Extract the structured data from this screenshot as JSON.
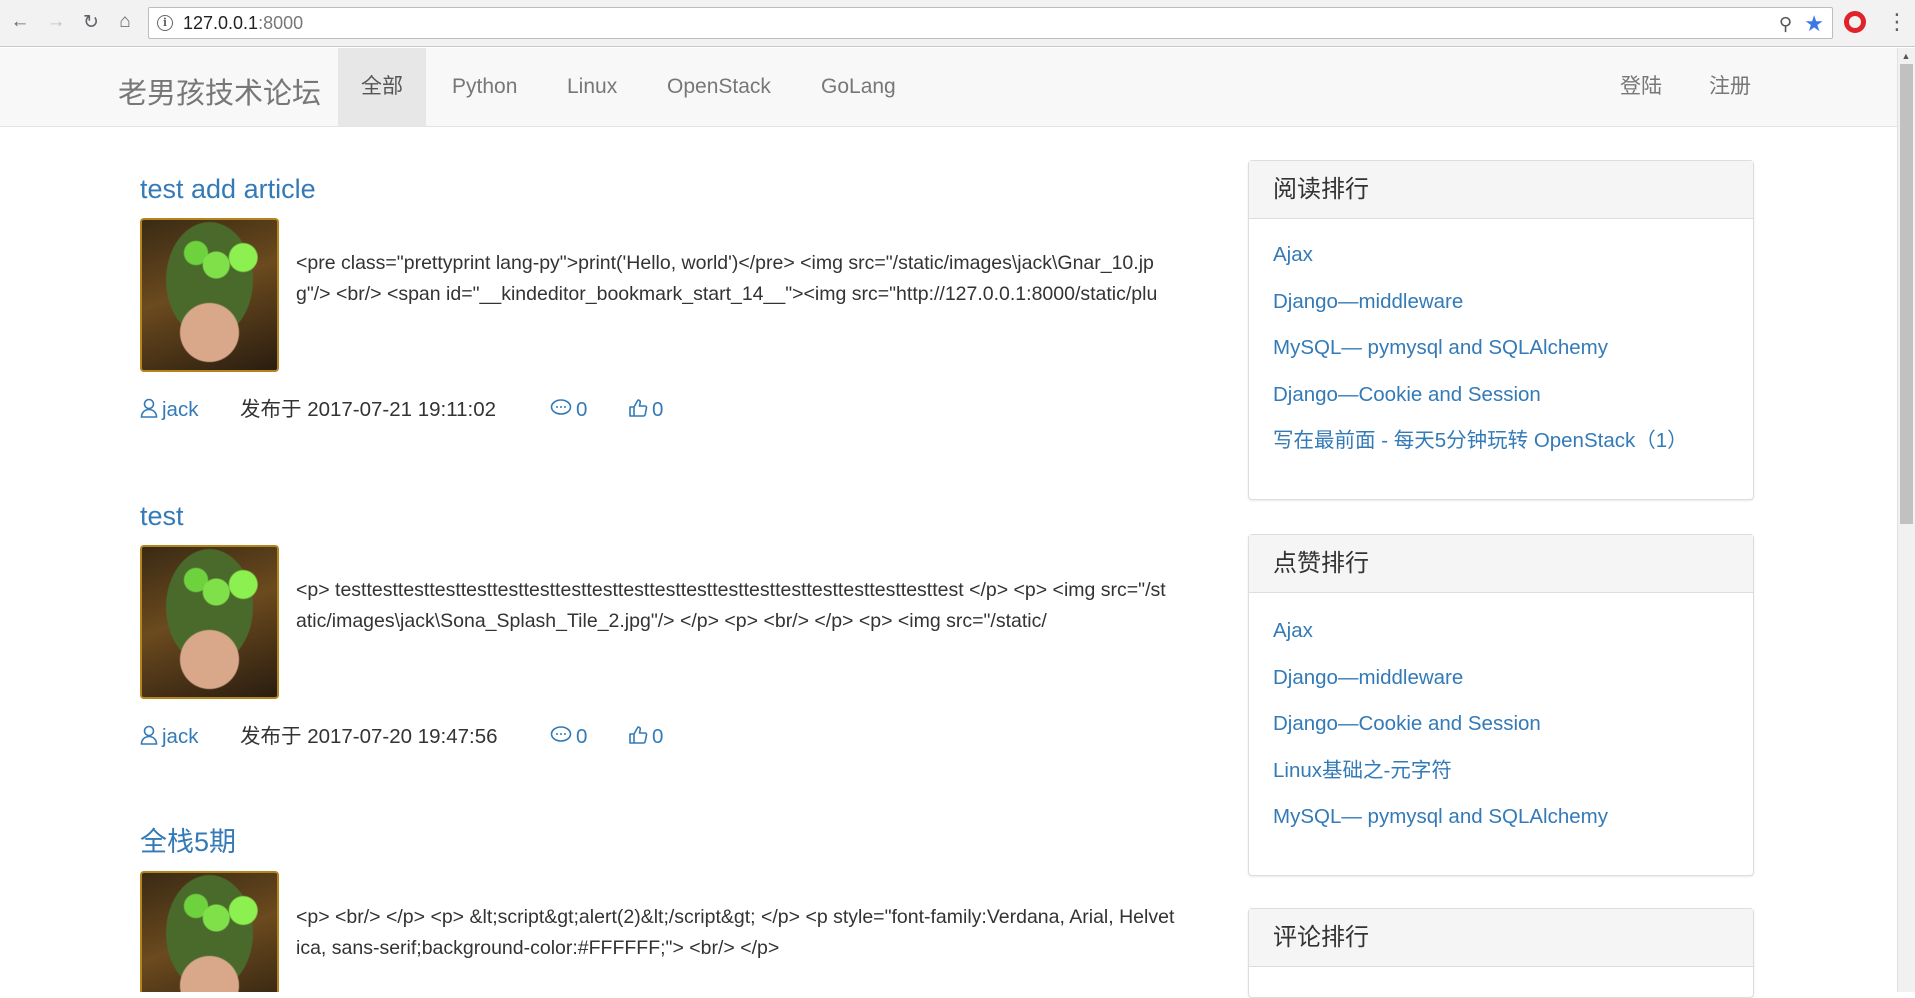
{
  "browser": {
    "url_host": "127.0.0.1",
    "url_port": ":8000"
  },
  "navbar": {
    "brand": "老男孩技术论坛",
    "items": [
      {
        "label": "全部",
        "active": true
      },
      {
        "label": "Python"
      },
      {
        "label": "Linux"
      },
      {
        "label": "OpenStack"
      },
      {
        "label": "GoLang"
      }
    ],
    "login": "登陆",
    "register": "注册"
  },
  "articles": [
    {
      "title": "test add article",
      "summary": "<pre class=\"prettyprint lang-py\">print('Hello, world')</pre> <img src=\"/static/images\\jack\\Gnar_10.jpg\"/> <br/> <span id=\"__kindeditor_bookmark_start_14__\"><img src=\"http://127.0.0.1:8000/static/plu",
      "author": "jack",
      "date": "发布于 2017-07-21 19:11:02",
      "comments": "0",
      "likes": "0"
    },
    {
      "title": "test",
      "summary": "<p> testtesttesttesttesttesttesttesttesttesttesttesttesttesttesttesttesttesttesttest </p> <p> <img src=\"/static/images\\jack\\Sona_Splash_Tile_2.jpg\"/> </p> <p> <br/> </p> <p> <img src=\"/static/",
      "author": "jack",
      "date": "发布于 2017-07-20 19:47:56",
      "comments": "0",
      "likes": "0"
    },
    {
      "title": "全栈5期",
      "summary": "<p> <br/> </p> <p> &lt;script&gt;alert(2)&lt;/script&gt; </p> <p style=\"font-family:Verdana, Arial, Helvetica, sans-serif;background-color:#FFFFFF;\"> <br/> </p>",
      "author": "",
      "date": "",
      "comments": "",
      "likes": ""
    }
  ],
  "sidebar": {
    "read_rank": {
      "title": "阅读排行",
      "items": [
        "Ajax",
        "Django—middleware",
        "MySQL— pymysql and SQLAlchemy",
        "Django—Cookie and Session",
        "写在最前面 - 每天5分钟玩转 OpenStack（1）"
      ]
    },
    "like_rank": {
      "title": "点赞排行",
      "items": [
        "Ajax",
        "Django—middleware",
        "Django—Cookie and Session",
        "Linux基础之-元字符",
        "MySQL— pymysql and SQLAlchemy"
      ]
    },
    "comment_rank": {
      "title": "评论排行"
    }
  },
  "colors": {
    "link": "#337ab7",
    "navbar_bg": "#f8f8f8",
    "nav_active_bg": "#e7e7e7"
  }
}
